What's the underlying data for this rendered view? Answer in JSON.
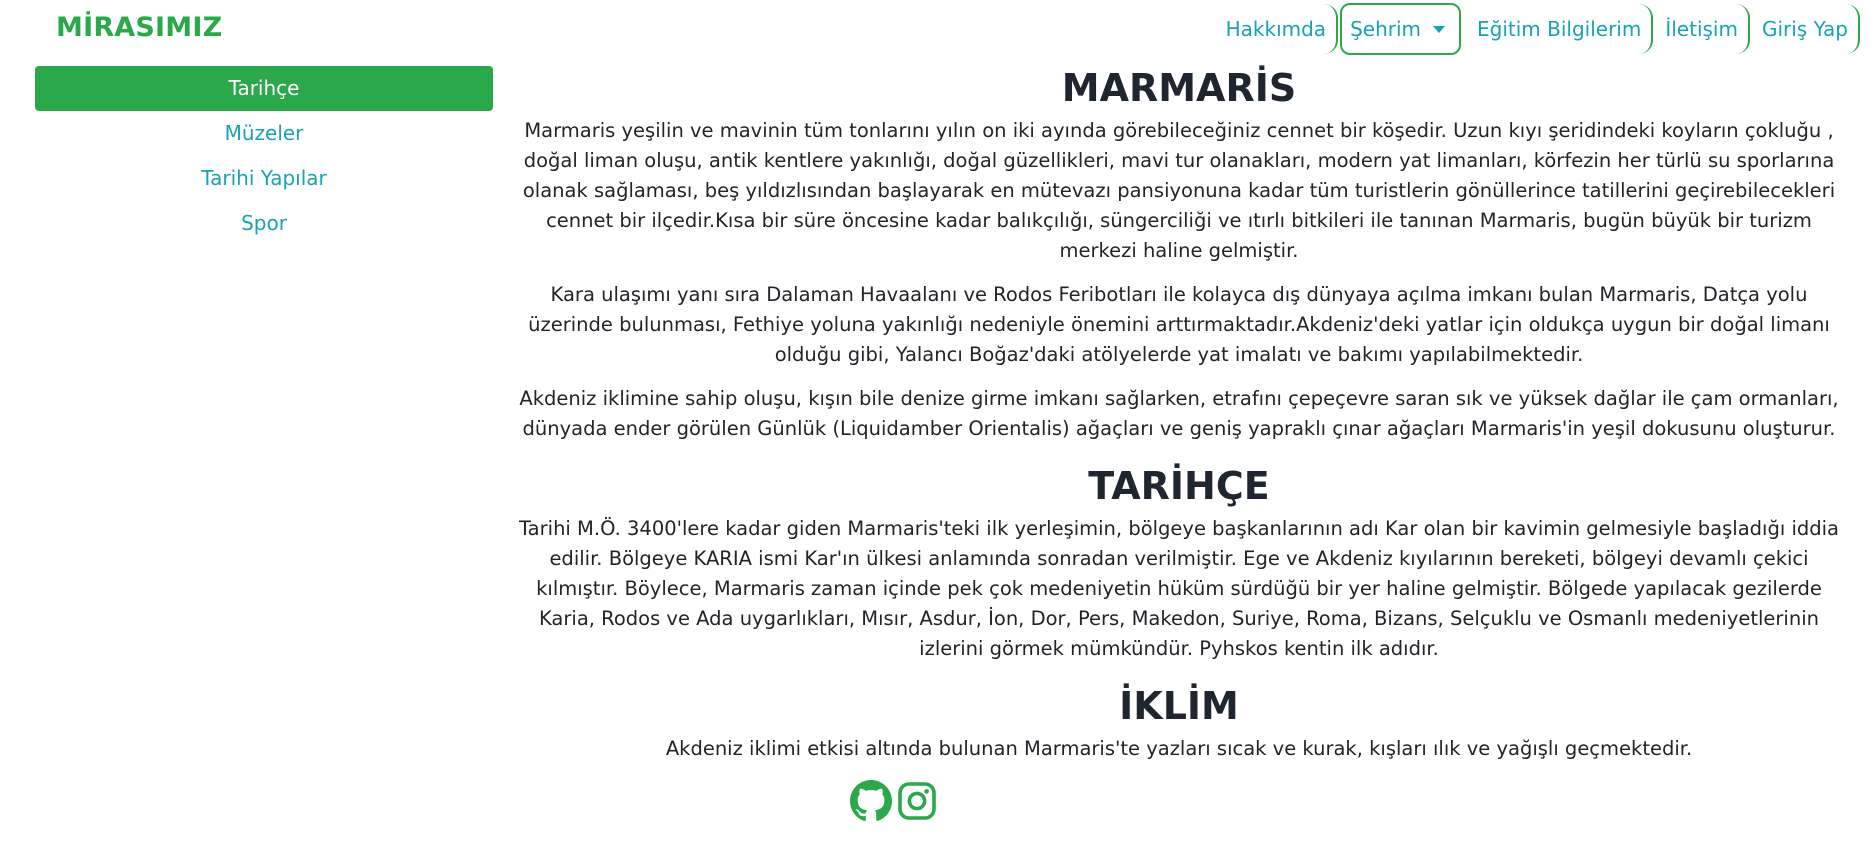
{
  "navbar": {
    "brand": "MİRASIMIZ",
    "links": [
      "Hakkımda",
      "Şehrim",
      "Eğitim Bilgilerim",
      "İletişim",
      "Giriş Yap"
    ]
  },
  "sidebar": {
    "items": [
      "Tarihçe",
      "Müzeler",
      "Tarihi Yapılar",
      "Spor"
    ],
    "active_index": 0
  },
  "sections": [
    {
      "title": "MARMARİS",
      "paragraphs": [
        "Marmaris yeşilin ve mavinin tüm tonlarını yılın on iki ayında görebileceğiniz cennet bir köşedir. Uzun kıyı şeridindeki koyların çokluğu , doğal liman oluşu, antik kentlere yakınlığı, doğal güzellikleri, mavi tur olanakları, modern yat limanları, körfezin her türlü su sporlarına olanak sağlaması, beş yıldızlısından başlayarak en mütevazı pansiyonuna kadar tüm turistlerin gönüllerince tatillerini geçirebilecekleri cennet bir ilçedir.Kısa bir süre öncesine kadar balıkçılığı, süngerciliği ve ıtırlı bitkileri ile tanınan Marmaris, bugün büyük bir turizm merkezi haline gelmiştir.",
        "Kara ulaşımı yanı sıra Dalaman Havaalanı ve Rodos Feribotları ile kolayca dış dünyaya açılma imkanı bulan Marmaris, Datça yolu üzerinde bulunması, Fethiye yoluna yakınlığı nedeniyle önemini arttırmaktadır.Akdeniz'deki yatlar için oldukça uygun bir doğal limanı olduğu gibi, Yalancı Boğaz'daki atölyelerde yat imalatı ve bakımı yapılabilmektedir.",
        "Akdeniz iklimine sahip oluşu, kışın bile denize girme imkanı sağlarken, etrafını çepeçevre saran sık ve yüksek dağlar ile çam ormanları, dünyada ender görülen Günlük (Liquidamber Orientalis) ağaçları ve geniş yapraklı çınar ağaçları Marmaris'in yeşil dokusunu oluşturur."
      ]
    },
    {
      "title": "TARİHÇE",
      "paragraphs": [
        "Tarihi M.Ö. 3400'lere kadar giden Marmaris'teki ilk yerleşimin, bölgeye başkanlarının adı Kar olan bir kavimin gelmesiyle başladığı iddia edilir. Bölgeye KARIA ismi Kar'ın ülkesi anlamında sonradan verilmiştir. Ege ve Akdeniz kıyılarının bereketi, bölgeyi devamlı çekici kılmıştır. Böylece, Marmaris zaman içinde pek çok medeniyetin hüküm sürdüğü bir yer haline gelmiştir. Bölgede yapılacak gezilerde Karia, Rodos ve Ada uygarlıkları, Mısır, Asdur, İon, Dor, Pers, Makedon, Suriye, Roma, Bizans, Selçuklu ve Osmanlı medeniyetlerinin izlerini görmek mümkündür. Pyhskos kentin ilk adıdır."
      ]
    },
    {
      "title": "İKLİM",
      "paragraphs": [
        "Akdeniz iklimi etkisi altında bulunan Marmaris'te yazları sıcak ve kurak, kışları ılık ve yağışlı geçmektedir."
      ]
    }
  ],
  "footer": {
    "icons": [
      "github-icon",
      "instagram-icon"
    ]
  },
  "colors": {
    "brand": "#2ba84a",
    "link": "#17a2b8",
    "text": "#212529"
  }
}
